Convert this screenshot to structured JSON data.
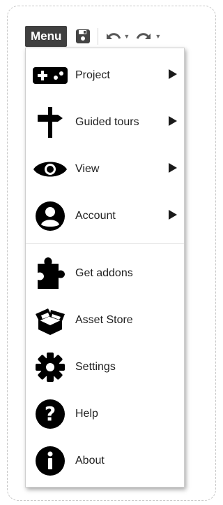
{
  "toolbar": {
    "menu_label": "Menu",
    "icons": [
      "save-icon",
      "undo-icon",
      "redo-icon"
    ]
  },
  "menu": {
    "items": [
      {
        "label": "Project",
        "icon": "gamepad-icon",
        "submenu": true
      },
      {
        "label": "Guided tours",
        "icon": "signpost-icon",
        "submenu": true
      },
      {
        "label": "View",
        "icon": "eye-icon",
        "submenu": true
      },
      {
        "label": "Account",
        "icon": "account-icon",
        "submenu": true
      },
      {
        "label": "Get addons",
        "icon": "puzzle-icon",
        "submenu": false
      },
      {
        "label": "Asset Store",
        "icon": "open-box-icon",
        "submenu": false
      },
      {
        "label": "Settings",
        "icon": "gear-icon",
        "submenu": false
      },
      {
        "label": "Help",
        "icon": "help-icon",
        "submenu": false
      },
      {
        "label": "About",
        "icon": "info-icon",
        "submenu": false
      }
    ]
  },
  "colors": {
    "menu_button": "#404040",
    "icon": "#000000",
    "arrow": "#1a1a1a"
  }
}
